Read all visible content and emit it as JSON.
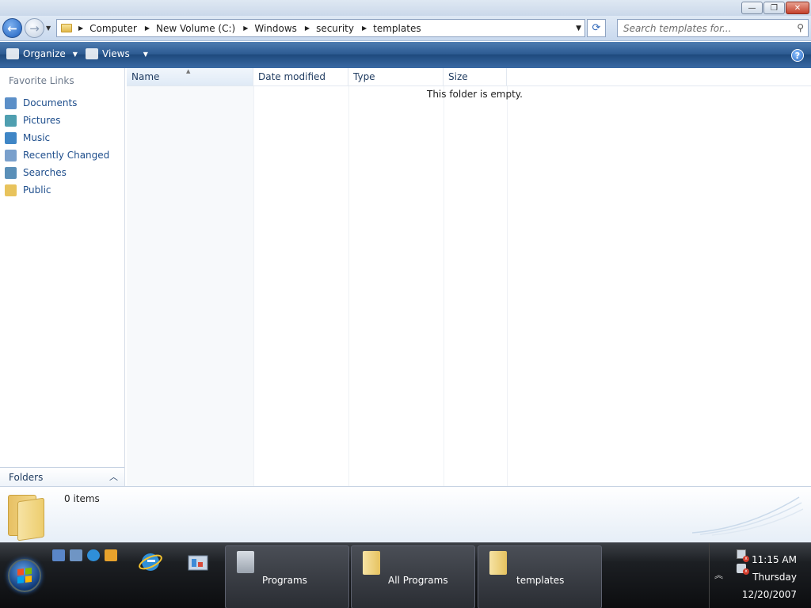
{
  "window": {
    "caption_buttons": {
      "minimize": "—",
      "maximize": "❐",
      "close": "✕"
    }
  },
  "navbar": {
    "back_glyph": "←",
    "forward_glyph": "→",
    "breadcrumbs": [
      "Computer",
      "New Volume (C:)",
      "Windows",
      "security",
      "templates"
    ],
    "search_placeholder": "Search templates for..."
  },
  "toolbar": {
    "organize_label": "Organize",
    "views_label": "Views",
    "help_glyph": "?"
  },
  "navpane": {
    "title": "Favorite Links",
    "items": [
      {
        "label": "Documents",
        "icon": "documents-icon",
        "color": "#5b8fc8"
      },
      {
        "label": "Pictures",
        "icon": "pictures-icon",
        "color": "#4f9fb0"
      },
      {
        "label": "Music",
        "icon": "music-icon",
        "color": "#3f86c6"
      },
      {
        "label": "Recently Changed",
        "icon": "recently-changed-icon",
        "color": "#7aa0cc"
      },
      {
        "label": "Searches",
        "icon": "searches-icon",
        "color": "#5a8fb8"
      },
      {
        "label": "Public",
        "icon": "public-folder-icon",
        "color": "#e8c35c"
      }
    ],
    "folders_label": "Folders"
  },
  "filelist": {
    "columns": [
      "Name",
      "Date modified",
      "Type",
      "Size"
    ],
    "empty_message": "This folder is empty."
  },
  "details": {
    "item_count": "0 items"
  },
  "taskbar": {
    "buttons": [
      {
        "label": "Programs",
        "icon": "programs-icon"
      },
      {
        "label": "All Programs",
        "icon": "folder-icon"
      },
      {
        "label": "templates",
        "icon": "folder-icon"
      }
    ],
    "clock": {
      "time": "11:15 AM",
      "day": "Thursday",
      "date": "12/20/2007"
    }
  },
  "colors": {
    "link": "#1e4e8c",
    "toolbar": "#2e5c93",
    "taskbar": "#1c1f23"
  }
}
